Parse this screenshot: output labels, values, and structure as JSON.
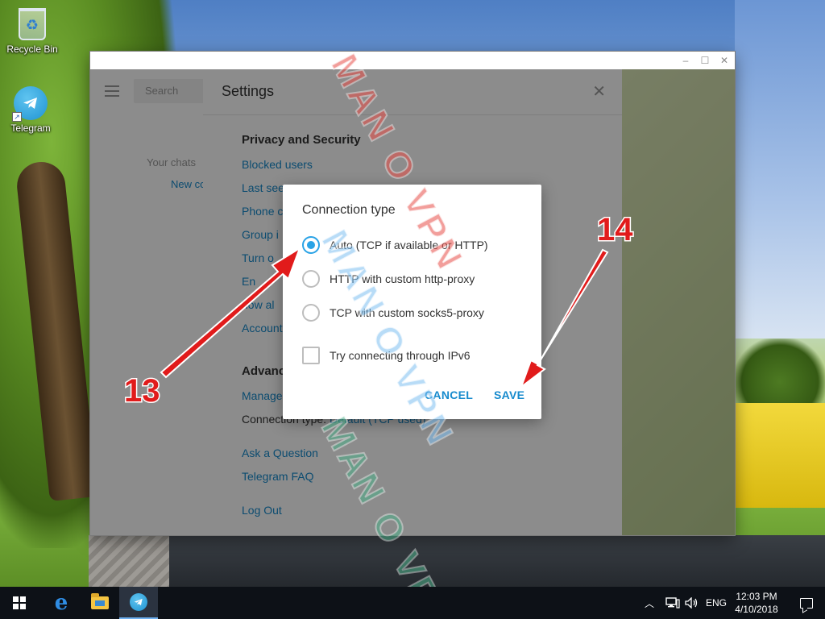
{
  "desktop": {
    "icons": [
      {
        "label": "Recycle Bin",
        "icon": "recycle-bin-icon"
      },
      {
        "label": "Telegram",
        "icon": "telegram-icon"
      }
    ]
  },
  "window": {
    "controls": {
      "minimize": "–",
      "maximize": "☐",
      "close": "✕"
    }
  },
  "sidebar": {
    "search_placeholder": "Search",
    "empty_text": "Your chats",
    "new_contact_text": "New co"
  },
  "settings": {
    "title": "Settings",
    "close_glyph": "✕",
    "privacy_title": "Privacy and Security",
    "privacy_items": [
      "Blocked users",
      "Last see",
      "Phone c",
      "Group i",
      "Turn o",
      "En",
      "how al",
      "Account"
    ],
    "advanced_title": "Advanc",
    "advanced_manage": "Manage",
    "connection_label": "Connection type:",
    "connection_value": "Default (TCP used)",
    "ask_question": "Ask a Question",
    "faq": "Telegram FAQ",
    "logout": "Log Out"
  },
  "dialog": {
    "title": "Connection type",
    "options": [
      {
        "label": "Auto (TCP if available or HTTP)",
        "selected": true
      },
      {
        "label": "HTTP with custom http-proxy",
        "selected": false
      },
      {
        "label": "TCP with custom socks5-proxy",
        "selected": false
      }
    ],
    "ipv6_label": "Try connecting through IPv6",
    "ipv6_checked": false,
    "cancel_label": "CANCEL",
    "save_label": "SAVE"
  },
  "annotations": {
    "step_13": "13",
    "step_14": "14",
    "arrow_color": "#e11b1b"
  },
  "watermark": {
    "line1": "MAN O VPN",
    "line2": "MAN O VPN",
    "line3": "MAN O VPN"
  },
  "taskbar": {
    "language": "ENG",
    "time": "12:03 PM",
    "date": "4/10/2018",
    "tray_icons": [
      "chevron-up-icon",
      "network-icon",
      "volume-icon"
    ]
  }
}
